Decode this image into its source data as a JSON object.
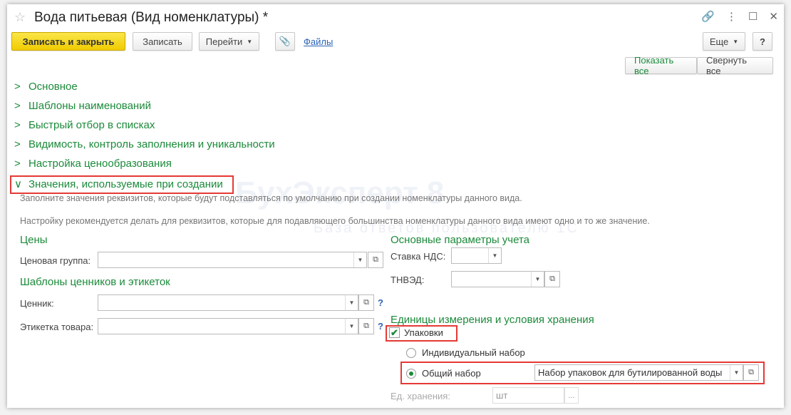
{
  "window": {
    "title": "Вода питьевая (Вид номенклатуры) *"
  },
  "toolbar": {
    "save_close": "Записать и закрыть",
    "save": "Записать",
    "goto": "Перейти",
    "files": "Файлы",
    "more": "Еще",
    "help": "?"
  },
  "view": {
    "show_all": "Показать все",
    "collapse_all": "Свернуть все"
  },
  "sections": [
    "Основное",
    "Шаблоны наименований",
    "Быстрый отбор в списках",
    "Видимость, контроль заполнения и уникальности",
    "Настройка ценообразования",
    "Значения, используемые при создании"
  ],
  "notes": [
    "Заполните значения реквизитов, которые будут подставляться по умолчанию при создании номенклатуры данного вида.",
    "Настройку рекомендуется делать для реквизитов, которые для подавляющего большинства номенклатуры данного вида имеют одно и то же значение."
  ],
  "watermark": {
    "brand": "БухЭксперт 8",
    "tagline": "База ответов пользователю 1С"
  },
  "prices": {
    "title": "Цены",
    "price_group_label": "Ценовая группа:",
    "price_group_value": ""
  },
  "templates": {
    "title": "Шаблоны ценников и этикеток",
    "tag_label": "Ценник:",
    "label_label": "Этикетка товара:"
  },
  "accounting": {
    "title": "Основные параметры учета",
    "vat_label": "Ставка НДС:",
    "tnved_label": "ТНВЭД:"
  },
  "units": {
    "title": "Единицы измерения и условия хранения",
    "packages_label": "Упаковки",
    "packages_checked": true,
    "individual_label": "Индивидуальный набор",
    "common_label": "Общий набор",
    "common_value": "Набор упаковок для бутилированной воды",
    "storage_label": "Ед. хранения:",
    "storage_value": "шт",
    "ellipsis": "..."
  }
}
